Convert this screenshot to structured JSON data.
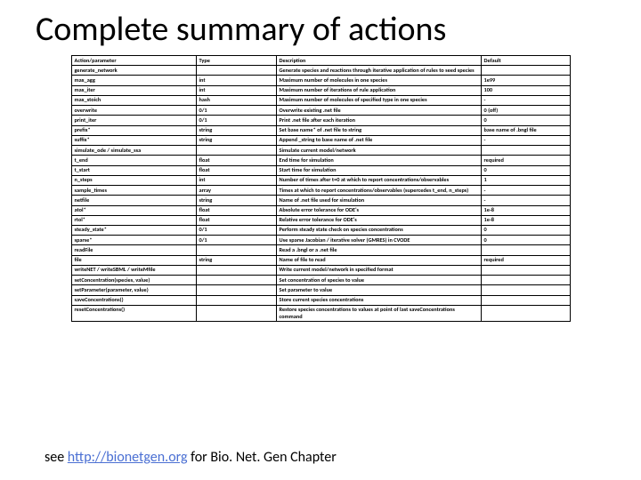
{
  "title": "Complete summary of actions",
  "headers": {
    "c1": "Action/parameter",
    "c2": "Type",
    "c3": "Description",
    "c4": "Default"
  },
  "rows": [
    {
      "c1": "generate_network",
      "c2": "",
      "c3": "Generate species and reactions through iterative application of rules to seed species",
      "c4": ""
    },
    {
      "c1": "max_agg",
      "c2": "int",
      "c3": "Maximum number of molecules in one species",
      "c4": "1e99"
    },
    {
      "c1": "max_iter",
      "c2": "int",
      "c3": "Maximum number of iterations of rule application",
      "c4": "100"
    },
    {
      "c1": "max_stoich",
      "c2": "hash",
      "c3": "Maximum number of molecules of specified type in one species",
      "c4": "-"
    },
    {
      "c1": "overwrite",
      "c2": "0/1",
      "c3": "Overwrite existing .net file",
      "c4": "0 (off)"
    },
    {
      "c1": "print_iter",
      "c2": "0/1",
      "c3": "Print .net file after each iteration",
      "c4": "0"
    },
    {
      "c1": "prefix*",
      "c2": "string",
      "c3": "Set base name* of .net file to string",
      "c4": "base name of .bngl file"
    },
    {
      "c1": "suffix*",
      "c2": "string",
      "c3": "Append _string to base name of .net file",
      "c4": "-"
    },
    {
      "c1": "simulate_ode / simulate_ssa",
      "c2": "",
      "c3": "Simulate current model/network",
      "c4": ""
    },
    {
      "c1": "t_end",
      "c2": "float",
      "c3": "End time for simulation",
      "c4": "required"
    },
    {
      "c1": "t_start",
      "c2": "float",
      "c3": "Start time for simulation",
      "c4": "0"
    },
    {
      "c1": "n_steps",
      "c2": "int",
      "c3": "Number of times after t=0 at which to report concentrations/observables",
      "c4": "1"
    },
    {
      "c1": "sample_times",
      "c2": "array",
      "c3": "Times at which to report concentrations/observables (supercedes t_end, n_steps)",
      "c4": "-"
    },
    {
      "c1": "netfile",
      "c2": "string",
      "c3": "Name of .net file used for simulation",
      "c4": "-"
    },
    {
      "c1": "atol*",
      "c2": "float",
      "c3": "Absolute error tolerance for ODE's",
      "c4": "1e-8"
    },
    {
      "c1": "rtol*",
      "c2": "float",
      "c3": "Relative error tolerance for ODE's",
      "c4": "1e-8"
    },
    {
      "c1": "steady_state*",
      "c2": "0/1",
      "c3": "Perform steady state check on species concentrations",
      "c4": "0"
    },
    {
      "c1": "sparse*",
      "c2": "0/1",
      "c3": "Use sparse Jacobian / iterative solver (GMRES) in CVODE",
      "c4": "0"
    },
    {
      "c1": "readFile",
      "c2": "",
      "c3": "Read a .bngl or a .net file",
      "c4": ""
    },
    {
      "c1": "file",
      "c2": "string",
      "c3": "Name of file to read",
      "c4": "required"
    },
    {
      "c1": "writeNET / writeSBML / writeMfile",
      "c2": "",
      "c3": "Write current model/network in specified format",
      "c4": ""
    },
    {
      "c1": "setConcentration(species, value)",
      "c2": "",
      "c3": "Set concentration of species to value",
      "c4": ""
    },
    {
      "c1": "setParameter(parameter, value)",
      "c2": "",
      "c3": "Set parameter to value",
      "c4": ""
    },
    {
      "c1": "saveConcentrations()",
      "c2": "",
      "c3": "Store current species concentrations",
      "c4": ""
    },
    {
      "c1": "resetConcentrations()",
      "c2": "",
      "c3": "Restore species concentrations to values at point of last saveConcentrations command",
      "c4": ""
    }
  ],
  "footer": {
    "pre": "see ",
    "link_text": "http://bionetgen.org",
    "link_href": "http://bionetgen.org",
    "post": " for Bio. Net. Gen Chapter"
  }
}
